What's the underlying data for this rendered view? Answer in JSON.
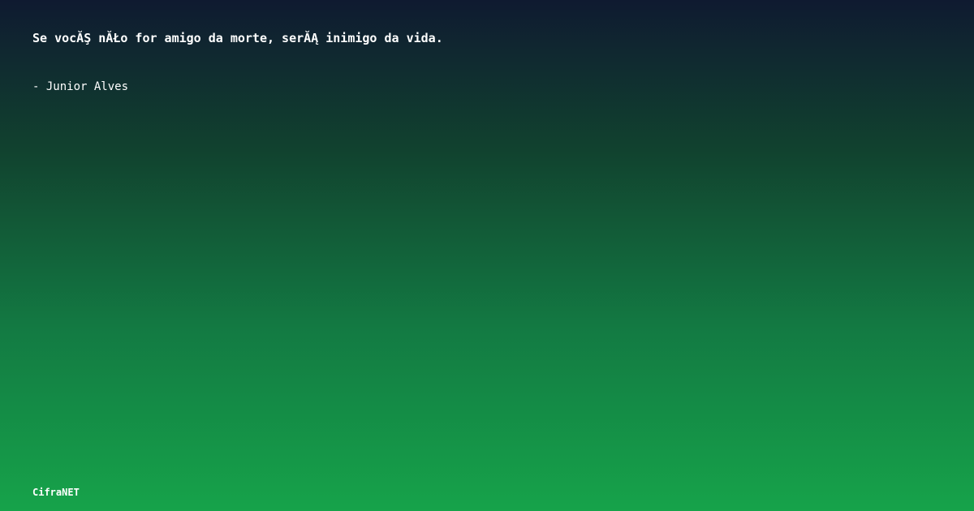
{
  "quote": {
    "text": "Se vocĂŞ nĂŁo for amigo da morte, serĂĄ inimigo da vida.",
    "author": "- Junior Alves"
  },
  "footer": {
    "brand": "CifraNET"
  },
  "colors": {
    "gradient_top": "#0f1a30",
    "gradient_bottom": "#16a34a",
    "text": "#ffffff"
  }
}
